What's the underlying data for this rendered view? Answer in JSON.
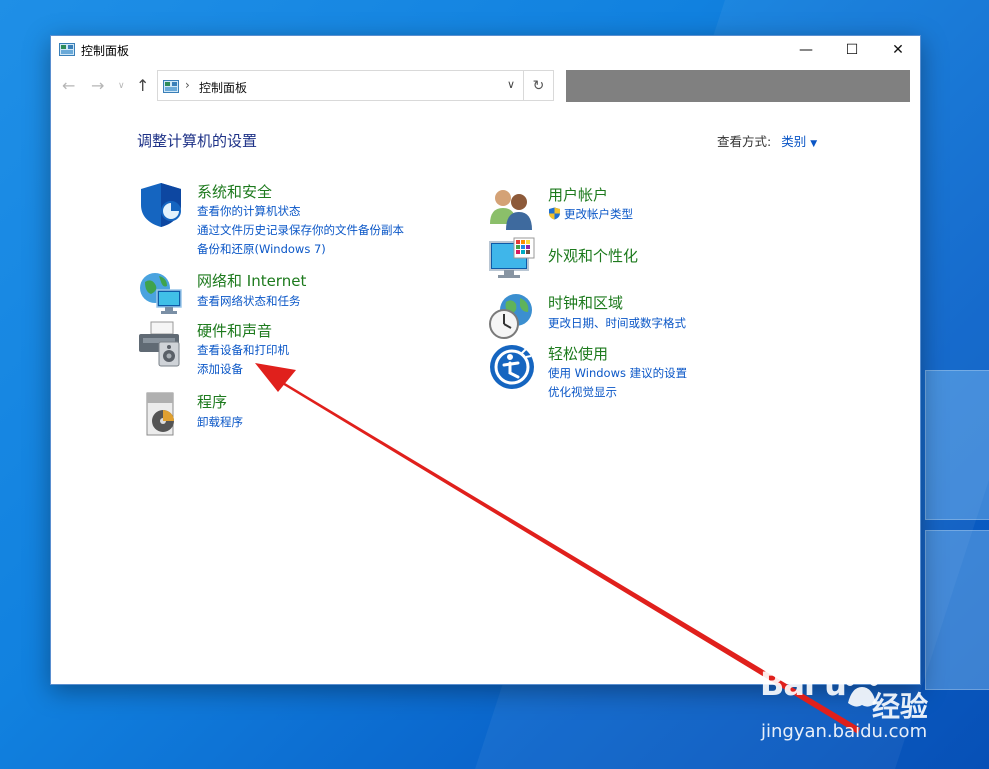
{
  "window": {
    "title": "控制面板",
    "min_glyph": "—",
    "max_glyph": "☐",
    "close_glyph": "✕"
  },
  "nav": {
    "back_glyph": "←",
    "forward_glyph": "→",
    "recent_glyph": "∨",
    "up_glyph": "↑",
    "breadcrumb_sep": "›",
    "breadcrumb": "控制面板",
    "dropdown_glyph": "∨",
    "refresh_glyph": "↻"
  },
  "main": {
    "heading": "调整计算机的设置",
    "view_by_label": "查看方式:",
    "view_by_value": "类别",
    "view_by_caret": "▼"
  },
  "categories_left": [
    {
      "title": "系统和安全",
      "links": [
        "查看你的计算机状态",
        "通过文件历史记录保存你的文件备份副本",
        "备份和还原(Windows 7)"
      ]
    },
    {
      "title": "网络和 Internet",
      "links": [
        "查看网络状态和任务"
      ]
    },
    {
      "title": "硬件和声音",
      "links": [
        "查看设备和打印机",
        "添加设备"
      ]
    },
    {
      "title": "程序",
      "links": [
        "卸载程序"
      ]
    }
  ],
  "categories_right": [
    {
      "title": "用户帐户",
      "links": [
        "更改帐户类型"
      ]
    },
    {
      "title": "外观和个性化",
      "links": []
    },
    {
      "title": "时钟和区域",
      "links": [
        "更改日期、时间或数字格式"
      ]
    },
    {
      "title": "轻松使用",
      "links": [
        "使用 Windows 建议的设置",
        "优化视觉显示"
      ]
    }
  ],
  "watermark": {
    "brand": "Bai  u",
    "cn": "经验",
    "url": "jingyan.baidu.com"
  },
  "colors": {
    "accent_link": "#0b57c7",
    "category_title": "#1d7a1d",
    "heading": "#1e3287",
    "annotation_arrow": "#e0201c"
  }
}
